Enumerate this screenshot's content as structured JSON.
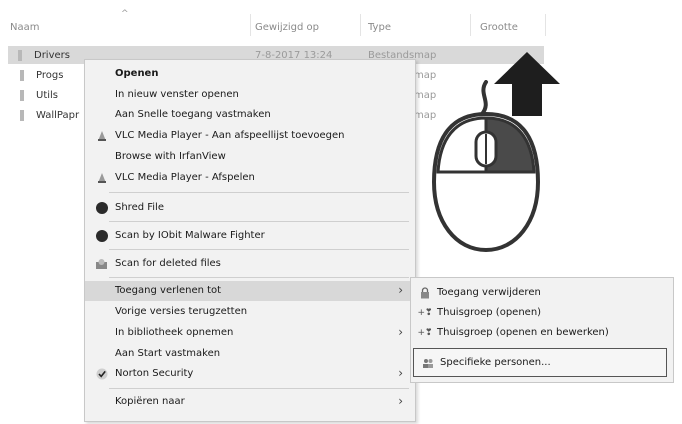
{
  "explorer": {
    "columns": {
      "name": "Naam",
      "modified": "Gewijzigd op",
      "type": "Type",
      "size": "Grootte"
    },
    "rows": [
      {
        "name": "Drivers",
        "modified": "7-8-2017 13:24",
        "type": "Bestandsmap"
      },
      {
        "name": "Progs",
        "type_partial": "map"
      },
      {
        "name": "Utils",
        "type_partial": "map"
      },
      {
        "name": "WallPapr",
        "type_partial": "map"
      }
    ]
  },
  "context_menu": {
    "items": [
      {
        "label": "Openen",
        "bold": true
      },
      {
        "label": "In nieuw venster openen"
      },
      {
        "label": "Aan Snelle toegang vastmaken"
      },
      {
        "label": "VLC Media Player - Aan afspeellijst toevoegen",
        "icon": "vlc-icon"
      },
      {
        "label": "Browse with IrfanView"
      },
      {
        "label": "VLC Media Player - Afspelen",
        "icon": "vlc-icon"
      },
      {
        "label": "Shred File",
        "icon": "shred-icon"
      },
      {
        "label": "Scan by IObit Malware Fighter",
        "icon": "iobit-icon"
      },
      {
        "label": "Scan for deleted files",
        "icon": "recover-icon"
      },
      {
        "label": "Toegang verlenen tot",
        "submenu": true
      },
      {
        "label": "Vorige versies terugzetten"
      },
      {
        "label": "In bibliotheek opnemen",
        "submenu": true
      },
      {
        "label": "Aan Start vastmaken"
      },
      {
        "label": "Norton Security",
        "icon": "norton-icon",
        "submenu": true
      },
      {
        "label": "Kopiëren naar",
        "submenu": true
      }
    ]
  },
  "submenu": {
    "items": [
      {
        "label": "Toegang verwijderen",
        "icon": "lock-icon"
      },
      {
        "label": "Thuisgroep (openen)",
        "icon": "homegroup-icon"
      },
      {
        "label": "Thuisgroep (openen en bewerken)",
        "icon": "homegroup-icon"
      },
      {
        "label": "Specifieke personen...",
        "icon": "people-icon"
      }
    ]
  },
  "colors": {
    "menu_bg": "#f2f2f2",
    "highlight": "#d8d8d8",
    "arrow": "#1e1e1e",
    "mouse_button": "#4a4a4a"
  }
}
